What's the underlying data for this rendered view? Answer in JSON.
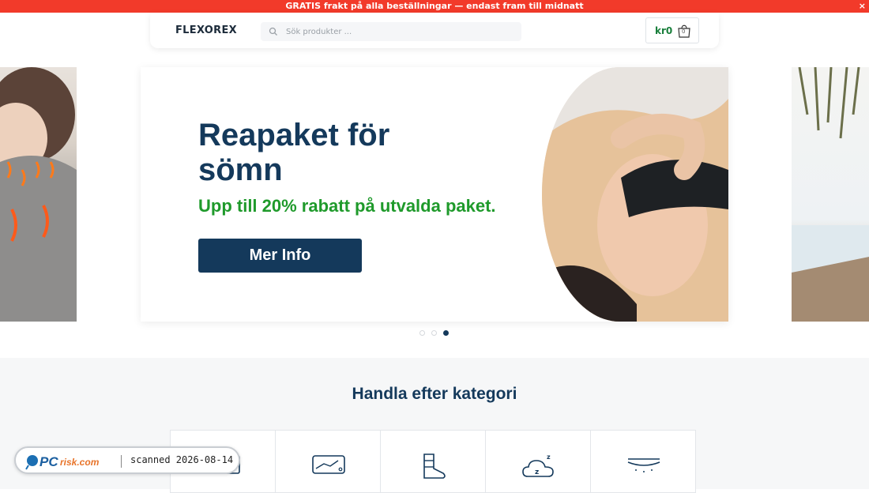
{
  "promo": {
    "text": "GRATIS frakt på alla beställningar — endast fram till midnatt",
    "close_label": "×"
  },
  "header": {
    "logo": "FLEXOREX",
    "search_placeholder": "Sök produkter ...",
    "cart_total": "kr0",
    "cart_count": "0"
  },
  "hero": {
    "title": "Reapaket för sömn",
    "subtitle": "Upp till 20% rabatt på utvalda paket.",
    "button_label": "Mer Info",
    "active_slide": 3,
    "slide_count": 3
  },
  "categories": {
    "title": "Handla efter kategori",
    "icons": [
      "heating-pad-icon",
      "massager-icon",
      "compression-sock-icon",
      "sleep-cloud-icon",
      "mattress-topper-icon"
    ]
  },
  "watermark": {
    "brand": "PCrisk.com",
    "text": "scanned 2026-08-14"
  },
  "colors": {
    "promo_bg": "#f23a2a",
    "brand_navy": "#14395b",
    "accent_green": "#1f9a2b"
  }
}
